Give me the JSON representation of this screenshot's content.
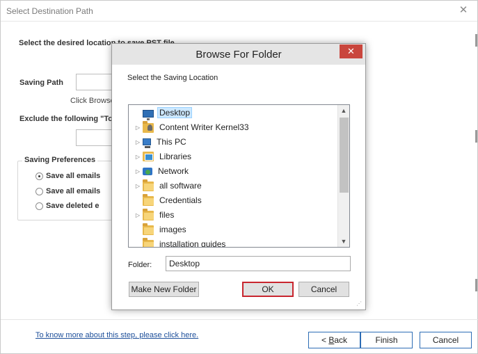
{
  "wizard": {
    "title": "Select Destination Path",
    "close_icon": "close-icon",
    "heading": "Select the desired location to save PST file",
    "saving_path_label": "Saving Path",
    "click_browse_text": "Click Browse",
    "exclude_label": "Exclude the following \"To",
    "preferences": {
      "legend": "Saving Preferences",
      "options": [
        {
          "label": "Save all emails",
          "checked": true
        },
        {
          "label": "Save all emails",
          "checked": false
        },
        {
          "label": "Save deleted e",
          "checked": false
        }
      ]
    },
    "help_link": "To know more about this step, please click here.",
    "buttons": {
      "back_prefix": "< ",
      "back_ul": "B",
      "back_rest": "ack",
      "finish": "Finish",
      "cancel": "Cancel"
    }
  },
  "browse_dialog": {
    "title": "Browse For Folder",
    "close_glyph": "✕",
    "prompt": "Select the Saving Location",
    "tree_items": [
      {
        "label": "Desktop",
        "icon": "desktop-icon",
        "expandable": false,
        "selected": true
      },
      {
        "label": "Content Writer Kernel33",
        "icon": "user-folder-icon",
        "expandable": true,
        "selected": false
      },
      {
        "label": "This PC",
        "icon": "computer-icon",
        "expandable": true,
        "selected": false
      },
      {
        "label": "Libraries",
        "icon": "libraries-icon",
        "expandable": true,
        "selected": false
      },
      {
        "label": "Network",
        "icon": "network-icon",
        "expandable": true,
        "selected": false
      },
      {
        "label": "all software",
        "icon": "folder-icon",
        "expandable": true,
        "selected": false
      },
      {
        "label": "Credentials",
        "icon": "folder-icon",
        "expandable": false,
        "selected": false
      },
      {
        "label": "files",
        "icon": "folder-icon",
        "expandable": true,
        "selected": false
      },
      {
        "label": "images",
        "icon": "folder-icon",
        "expandable": false,
        "selected": false
      },
      {
        "label": "installation guides",
        "icon": "folder-icon",
        "expandable": false,
        "selected": false
      }
    ],
    "folder_label": "Folder:",
    "folder_value": "Desktop",
    "buttons": {
      "new_folder": "Make New Folder",
      "ok": "OK",
      "cancel": "Cancel"
    }
  },
  "colors": {
    "accent_blue": "#2c6cb5",
    "close_red": "#c9463d",
    "ok_border": "#c8252e",
    "selection": "#cce8ff"
  }
}
